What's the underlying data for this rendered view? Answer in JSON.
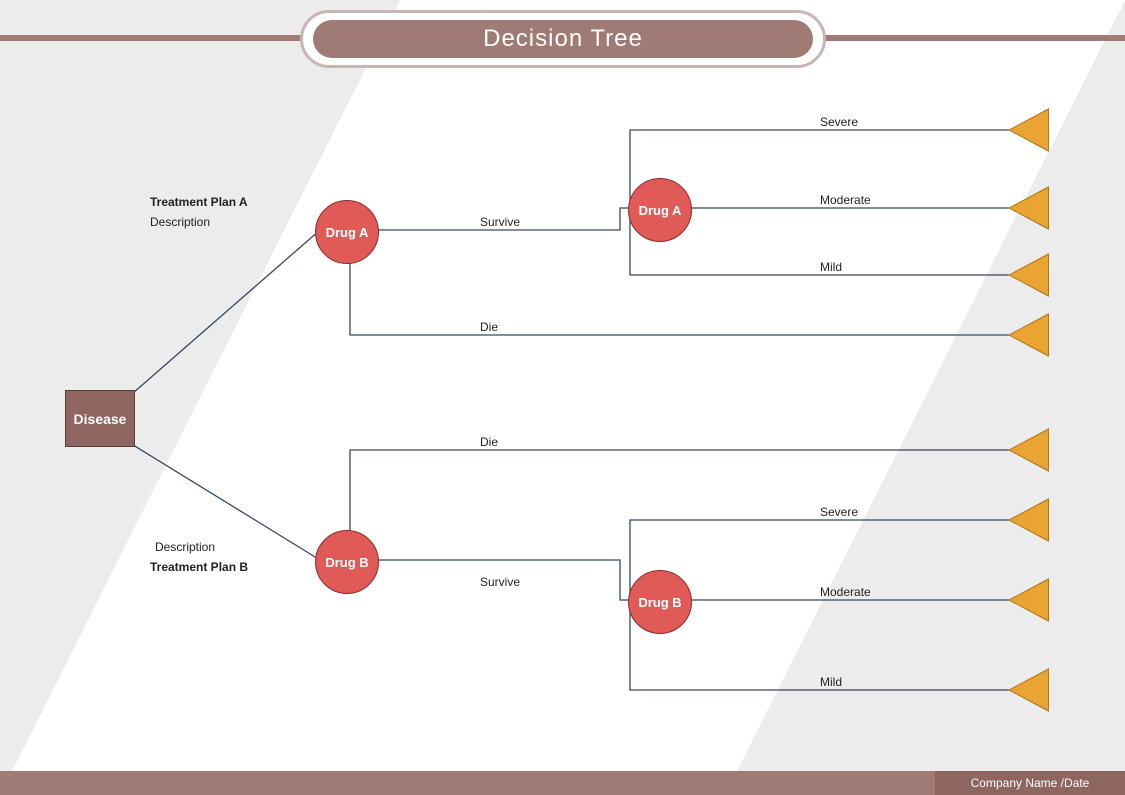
{
  "title": "Decision Tree",
  "footer": "Company Name /Date",
  "root": {
    "label": "Disease"
  },
  "planA": {
    "title": "Treatment Plan A",
    "desc": "Description",
    "node1": "Drug A",
    "survive": "Survive",
    "die": "Die",
    "node2": "Drug A",
    "outcomes": {
      "severe": "Severe",
      "moderate": "Moderate",
      "mild": "Mild"
    }
  },
  "planB": {
    "title": "Treatment Plan B",
    "desc": "Description",
    "node1": "Drug  B",
    "survive": "Survive",
    "die": "Die",
    "node2": "Drug  B",
    "outcomes": {
      "severe": "Severe",
      "moderate": "Moderate",
      "mild": "Mild"
    }
  },
  "chart_data": {
    "type": "decision-tree",
    "root": {
      "label": "Disease",
      "shape": "square",
      "children": [
        {
          "edge": "Treatment Plan A",
          "desc": "Description",
          "label": "Drug A",
          "shape": "circle",
          "children": [
            {
              "edge": "Survive",
              "label": "Drug A",
              "shape": "circle",
              "children": [
                {
                  "edge": "Severe",
                  "shape": "triangle"
                },
                {
                  "edge": "Moderate",
                  "shape": "triangle"
                },
                {
                  "edge": "Mild",
                  "shape": "triangle"
                }
              ]
            },
            {
              "edge": "Die",
              "shape": "triangle"
            }
          ]
        },
        {
          "edge": "Treatment Plan B",
          "desc": "Description",
          "label": "Drug  B",
          "shape": "circle",
          "children": [
            {
              "edge": "Die",
              "shape": "triangle"
            },
            {
              "edge": "Survive",
              "label": "Drug  B",
              "shape": "circle",
              "children": [
                {
                  "edge": "Severe",
                  "shape": "triangle"
                },
                {
                  "edge": "Moderate",
                  "shape": "triangle"
                },
                {
                  "edge": "Mild",
                  "shape": "triangle"
                }
              ]
            }
          ]
        }
      ]
    }
  }
}
